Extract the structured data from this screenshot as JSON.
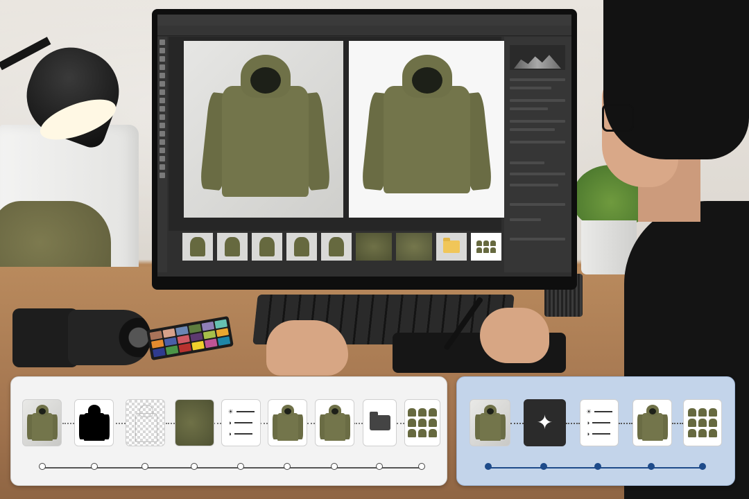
{
  "editor": {
    "menu": [
      "",
      "",
      "",
      "",
      "",
      "",
      "",
      ""
    ]
  },
  "workflow_left": {
    "steps": [
      {
        "name": "raw-photo",
        "kind": "photo"
      },
      {
        "name": "silhouette-mask",
        "kind": "mask"
      },
      {
        "name": "background-removed",
        "kind": "transparent"
      },
      {
        "name": "fabric-detail",
        "kind": "fabric"
      },
      {
        "name": "adjustments",
        "kind": "adjust"
      },
      {
        "name": "retouched-jacket",
        "kind": "jacket"
      },
      {
        "name": "final-jacket",
        "kind": "jacket"
      },
      {
        "name": "export-folder",
        "kind": "folder"
      },
      {
        "name": "batch-grid",
        "kind": "grid"
      }
    ]
  },
  "workflow_right": {
    "steps": [
      {
        "name": "raw-photo",
        "kind": "photo"
      },
      {
        "name": "ai-magic",
        "kind": "sparkle"
      },
      {
        "name": "adjustments",
        "kind": "adjust"
      },
      {
        "name": "final-jacket",
        "kind": "jacket"
      },
      {
        "name": "batch-grid",
        "kind": "grid"
      }
    ]
  },
  "icons": {
    "sun": "☀",
    "contrast": "◑",
    "sparkle": "✦"
  },
  "colors": {
    "jacket": "#73754b",
    "accent_blue": "#1e4b8a",
    "right_panel_bg": "#c3d4ea"
  }
}
